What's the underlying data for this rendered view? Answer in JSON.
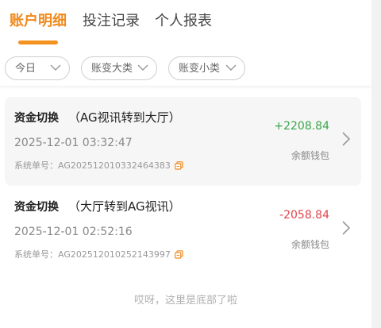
{
  "tabs": [
    {
      "label": "账户明细",
      "active": true
    },
    {
      "label": "投注记录",
      "active": false
    },
    {
      "label": "个人报表",
      "active": false
    }
  ],
  "filters": [
    {
      "label": "今日"
    },
    {
      "label": "账变大类"
    },
    {
      "label": "账变小类"
    }
  ],
  "records": [
    {
      "type": "资金切换",
      "detail": "（AG视讯转到大厅）",
      "time": "2025-12-01 03:32:47",
      "order": "系统单号：AG202512010332464383",
      "amount": "+2208.84",
      "wallet": "余额钱包"
    },
    {
      "type": "资金切换",
      "detail": "（大厅转到AG视讯）",
      "time": "2025-12-01 02:52:16",
      "order": "系统单号：AG202512010252143997",
      "amount": "-2058.84",
      "wallet": "余额钱包"
    }
  ],
  "footer_text": "哎呀，这里是底部了啦",
  "colors": {
    "accent": "#f08a1c",
    "positive": "#3aa64a",
    "negative": "#e0454b"
  },
  "icons": {
    "copy": "copy-icon",
    "chevron": "chevron-right-icon",
    "dropdown": "chevron-down-icon"
  }
}
